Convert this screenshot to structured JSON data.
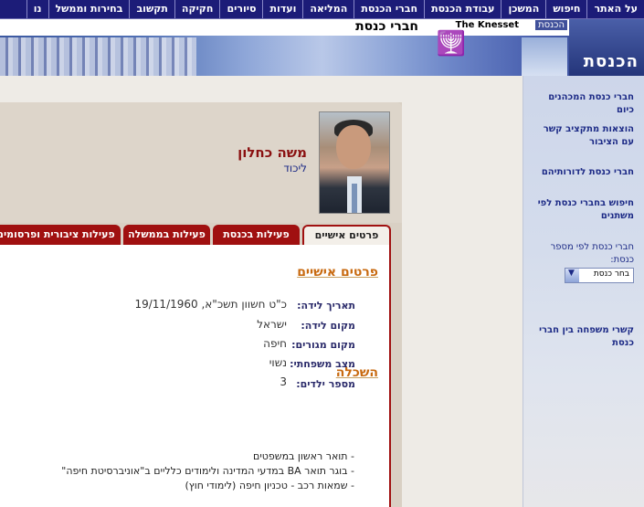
{
  "topnav": [
    "על האתר",
    "חיפוש",
    "המשכן",
    "עבודת הכנסת",
    "חברי הכנסת",
    "המליאה",
    "ועדות",
    "סיורים",
    "חקיקה",
    "תקשוב",
    "בחירות וממשל",
    "נו"
  ],
  "banner": {
    "section_title": "חברי כנסת",
    "knesset_en": "The Knesset",
    "knesset_he": "הכנסת",
    "logo_text": "הכנסת"
  },
  "sidebar": {
    "links": [
      "חברי כנסת המכהנים כיום",
      "הוצאות מתקציב קשר עם הציבור",
      "חברי כנסת לדורותיהם",
      "חיפוש בחברי כנסת לפי משתנים"
    ],
    "select_label": "חברי כנסת לפי מספר כנסת:",
    "select_value": "בחר כנסת",
    "family_link": "קשרי משפחה בין חברי כנסת"
  },
  "profile": {
    "name": "משה כחלון",
    "party": "ליכוד"
  },
  "tabs": [
    "פרטים אישיים",
    "פעילות בכנסת",
    "פעילות בממשלה",
    "פעילות ציבורית ופרסומים"
  ],
  "personal": {
    "title": "פרטים אישיים",
    "rows": [
      {
        "label": "תאריך לידה:",
        "value": "כ\"ט חשוון תשכ\"א, 19/11/1960"
      },
      {
        "label": "מקום לידה:",
        "value": "ישראל"
      },
      {
        "label": "מקום מגורים:",
        "value": "חיפה"
      },
      {
        "label": "מצב משפחתי:",
        "value": "נשוי"
      },
      {
        "label": "מספר ילדים:",
        "value": "3"
      }
    ]
  },
  "education": {
    "title": "השכלה",
    "items": [
      "- תואר ראשון במשפטים",
      "- בוגר תואר BA במדעי המדינה ולימודים כלליים ב\"אוניברסיטת חיפה\"",
      "- שמאות רכב - טכניון חיפה (לימודי חוץ)"
    ]
  }
}
